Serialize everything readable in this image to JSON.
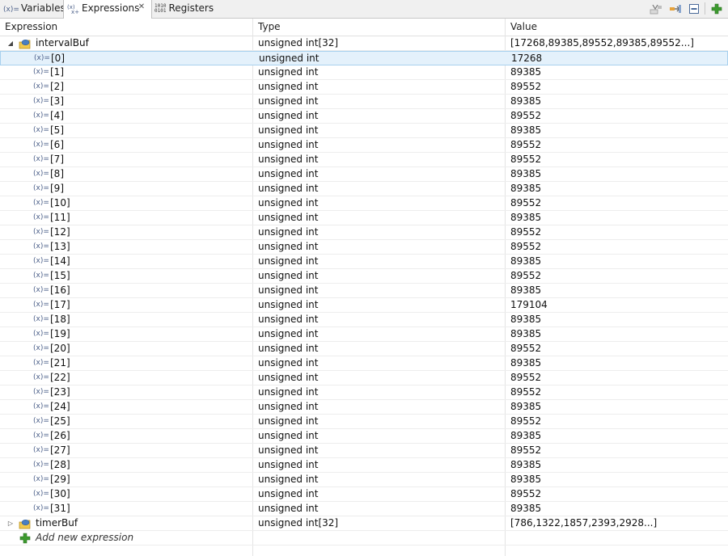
{
  "tabs": {
    "variables": {
      "icon_text": "(x)=",
      "label": "Variables"
    },
    "expressions": {
      "label": "Expressions",
      "close": "✕"
    },
    "registers": {
      "icon_text_top": "1010",
      "icon_text_bottom": "0101",
      "label": "Registers"
    }
  },
  "columns": {
    "expression": "Expression",
    "type": "Type",
    "value": "Value"
  },
  "var_icon_text": "(x)=",
  "expressions": [
    {
      "name": "intervalBuf",
      "type": "unsigned int[32]",
      "value": "[17268,89385,89552,89385,89552...]",
      "expanded": true,
      "children": [
        {
          "name": "[0]",
          "type": "unsigned int",
          "value": "17268"
        },
        {
          "name": "[1]",
          "type": "unsigned int",
          "value": "89385"
        },
        {
          "name": "[2]",
          "type": "unsigned int",
          "value": "89552"
        },
        {
          "name": "[3]",
          "type": "unsigned int",
          "value": "89385"
        },
        {
          "name": "[4]",
          "type": "unsigned int",
          "value": "89552"
        },
        {
          "name": "[5]",
          "type": "unsigned int",
          "value": "89385"
        },
        {
          "name": "[6]",
          "type": "unsigned int",
          "value": "89552"
        },
        {
          "name": "[7]",
          "type": "unsigned int",
          "value": "89552"
        },
        {
          "name": "[8]",
          "type": "unsigned int",
          "value": "89385"
        },
        {
          "name": "[9]",
          "type": "unsigned int",
          "value": "89385"
        },
        {
          "name": "[10]",
          "type": "unsigned int",
          "value": "89552"
        },
        {
          "name": "[11]",
          "type": "unsigned int",
          "value": "89385"
        },
        {
          "name": "[12]",
          "type": "unsigned int",
          "value": "89552"
        },
        {
          "name": "[13]",
          "type": "unsigned int",
          "value": "89552"
        },
        {
          "name": "[14]",
          "type": "unsigned int",
          "value": "89385"
        },
        {
          "name": "[15]",
          "type": "unsigned int",
          "value": "89552"
        },
        {
          "name": "[16]",
          "type": "unsigned int",
          "value": "89385"
        },
        {
          "name": "[17]",
          "type": "unsigned int",
          "value": "179104"
        },
        {
          "name": "[18]",
          "type": "unsigned int",
          "value": "89385"
        },
        {
          "name": "[19]",
          "type": "unsigned int",
          "value": "89385"
        },
        {
          "name": "[20]",
          "type": "unsigned int",
          "value": "89552"
        },
        {
          "name": "[21]",
          "type": "unsigned int",
          "value": "89385"
        },
        {
          "name": "[22]",
          "type": "unsigned int",
          "value": "89552"
        },
        {
          "name": "[23]",
          "type": "unsigned int",
          "value": "89552"
        },
        {
          "name": "[24]",
          "type": "unsigned int",
          "value": "89385"
        },
        {
          "name": "[25]",
          "type": "unsigned int",
          "value": "89552"
        },
        {
          "name": "[26]",
          "type": "unsigned int",
          "value": "89385"
        },
        {
          "name": "[27]",
          "type": "unsigned int",
          "value": "89552"
        },
        {
          "name": "[28]",
          "type": "unsigned int",
          "value": "89385"
        },
        {
          "name": "[29]",
          "type": "unsigned int",
          "value": "89385"
        },
        {
          "name": "[30]",
          "type": "unsigned int",
          "value": "89552"
        },
        {
          "name": "[31]",
          "type": "unsigned int",
          "value": "89385"
        }
      ]
    },
    {
      "name": "timerBuf",
      "type": "unsigned int[32]",
      "value": "[786,1322,1857,2393,2928...]",
      "expanded": false,
      "children": []
    }
  ],
  "selected_child_index": 0,
  "add_expression": {
    "label": "Add new expression"
  },
  "toolbar": {
    "icons": [
      "show-type-names-icon",
      "collapse-all-icon",
      "minimize-icon",
      "add-expression-icon"
    ]
  },
  "colors": {
    "selection": "#e4f1fb",
    "add_green": "#3c9a2e",
    "struct_yellow": "#f2c94c",
    "struct_blue": "#4a7fc1"
  }
}
